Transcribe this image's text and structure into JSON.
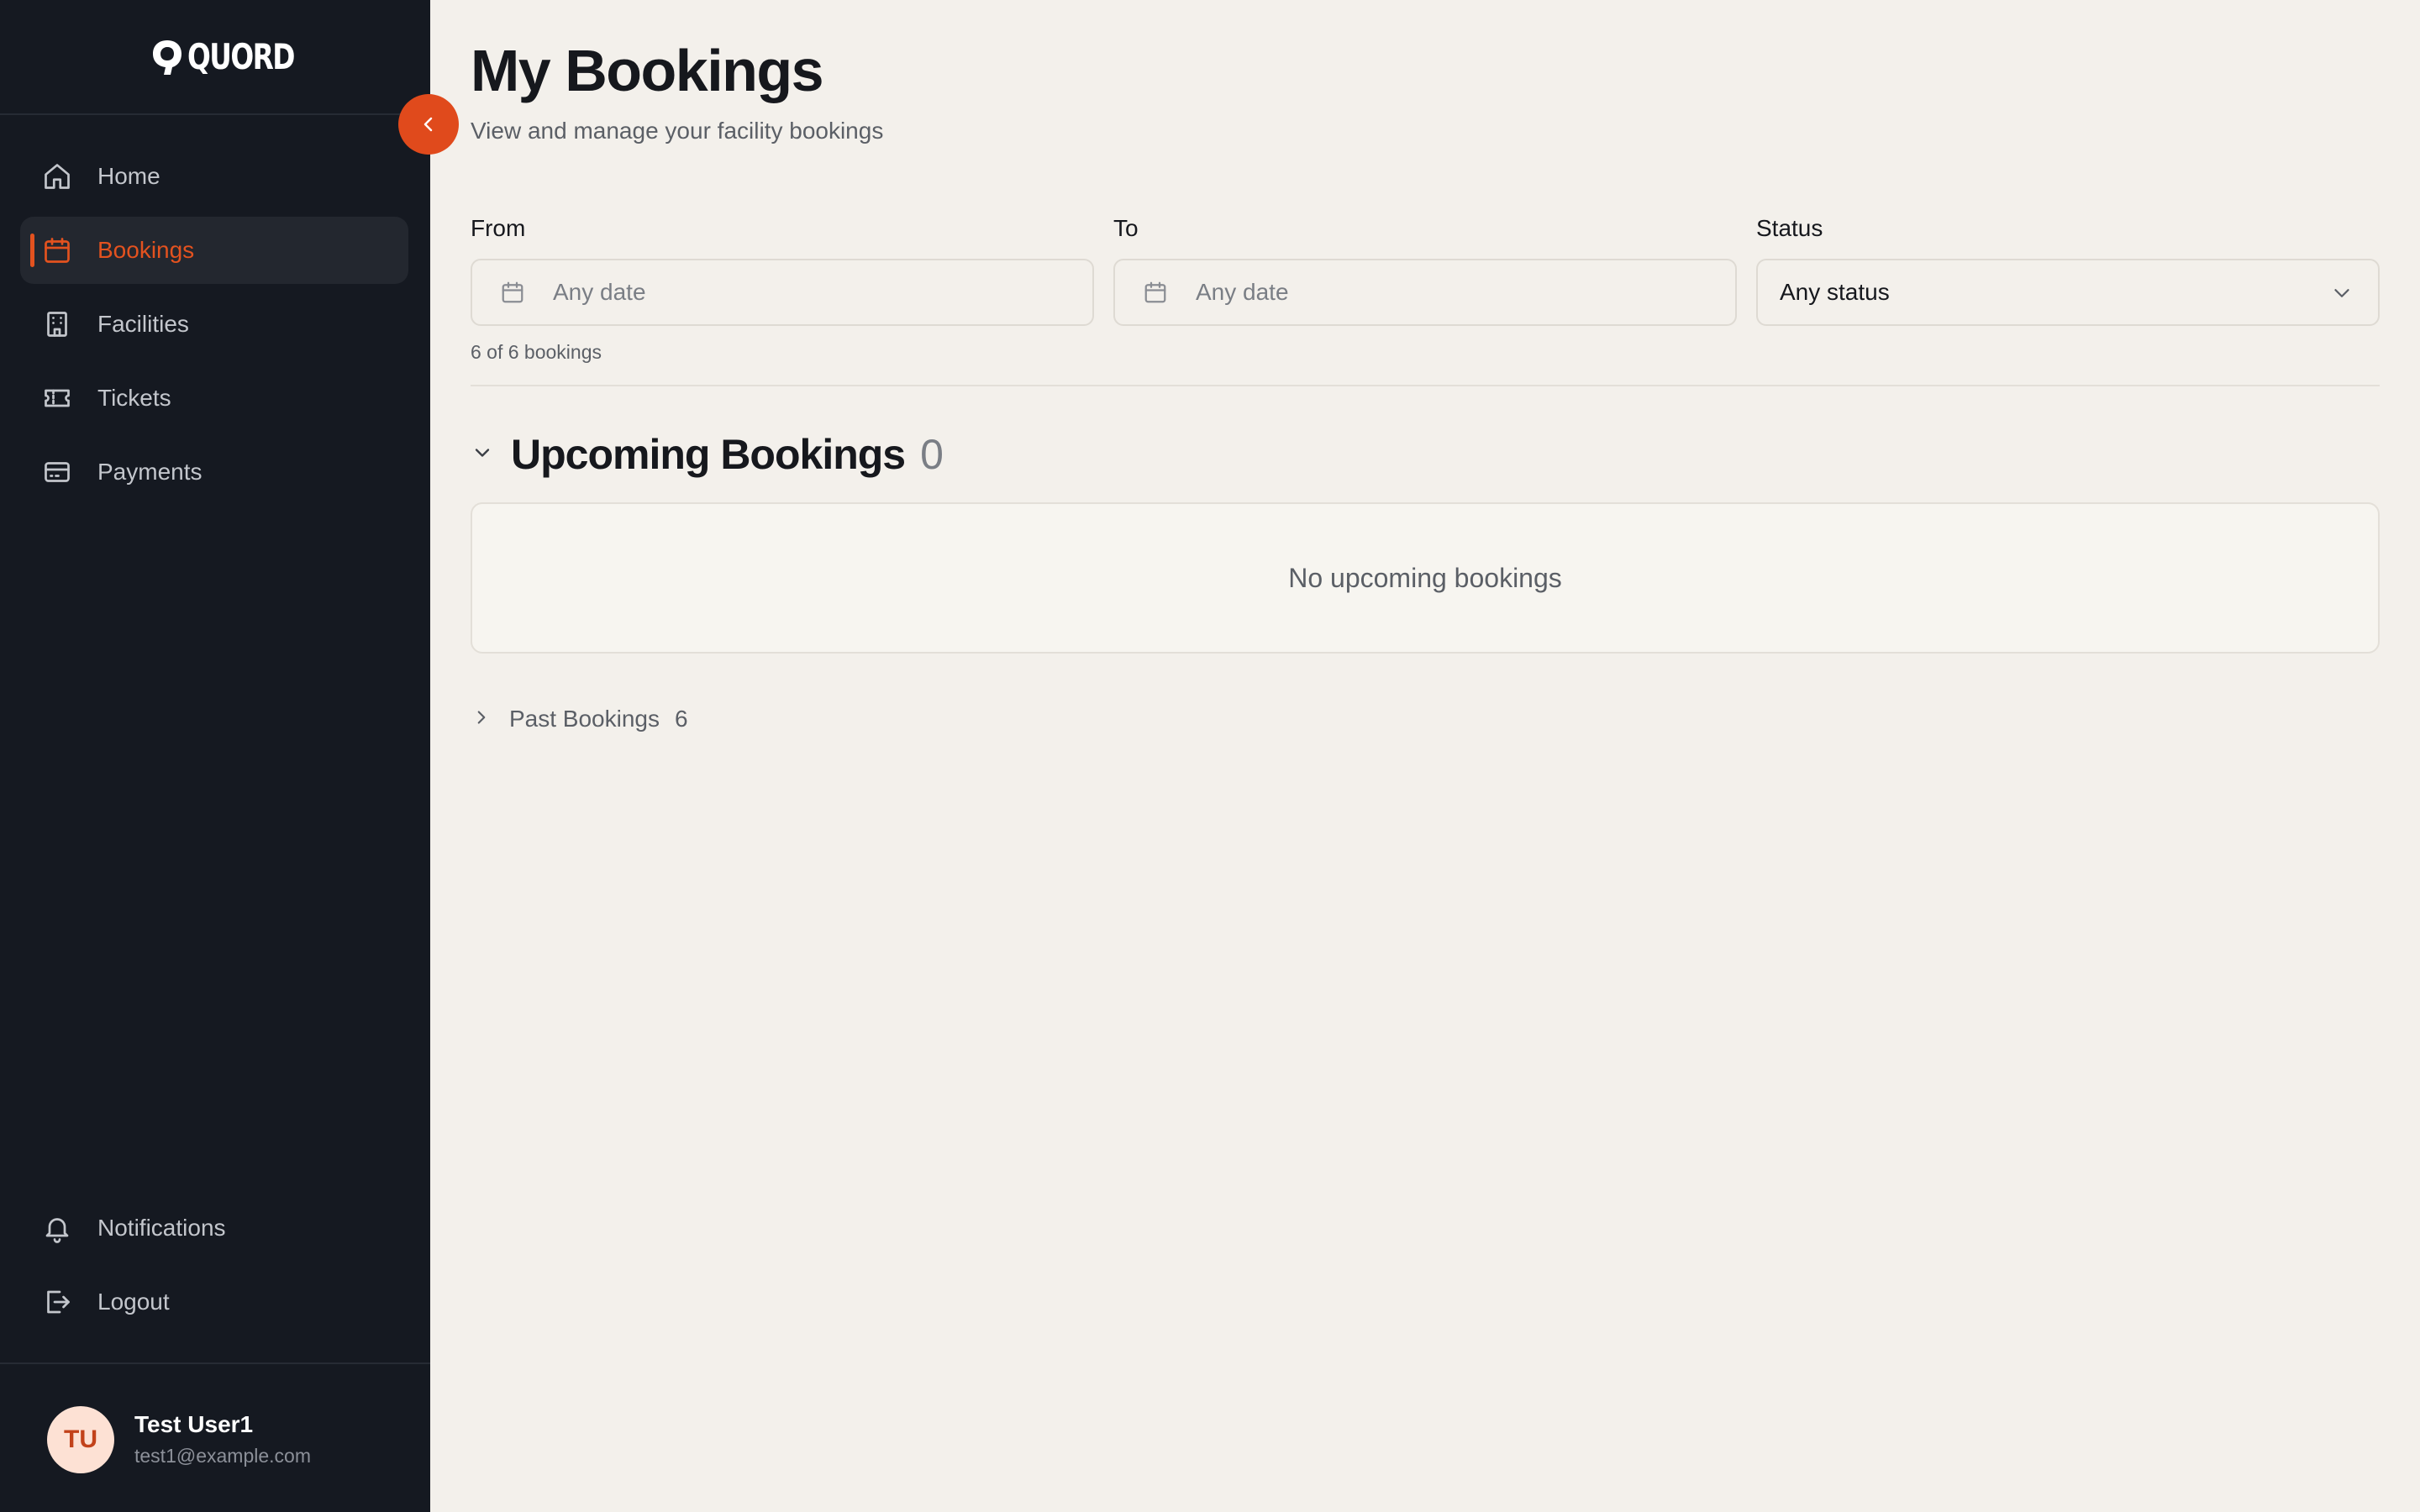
{
  "app": {
    "logo_text": "QUORD"
  },
  "sidebar": {
    "items": [
      {
        "label": "Home",
        "icon": "home-icon"
      },
      {
        "label": "Bookings",
        "icon": "calendar-icon",
        "active": true
      },
      {
        "label": "Facilities",
        "icon": "building-icon"
      },
      {
        "label": "Tickets",
        "icon": "ticket-icon"
      },
      {
        "label": "Payments",
        "icon": "credit-card-icon"
      }
    ],
    "bottom_items": [
      {
        "label": "Notifications",
        "icon": "bell-icon"
      },
      {
        "label": "Logout",
        "icon": "logout-icon"
      }
    ],
    "collapse_icon": "chevron-left-icon"
  },
  "user": {
    "initials": "TU",
    "name": "Test User1",
    "email": "test1@example.com"
  },
  "page": {
    "title": "My Bookings",
    "subtitle": "View and manage your facility bookings"
  },
  "filters": {
    "from": {
      "label": "From",
      "placeholder": "Any date"
    },
    "to": {
      "label": "To",
      "placeholder": "Any date"
    },
    "status": {
      "label": "Status",
      "value": "Any status"
    }
  },
  "count_text": "6 of 6 bookings",
  "upcoming": {
    "title": "Upcoming Bookings",
    "count": "0",
    "empty_text": "No upcoming bookings",
    "expanded": true
  },
  "past": {
    "title": "Past Bookings",
    "count": "6",
    "expanded": false
  },
  "colors": {
    "accent": "#e3521f",
    "sidebar_bg": "#151921",
    "main_bg": "#f3f0eb"
  }
}
